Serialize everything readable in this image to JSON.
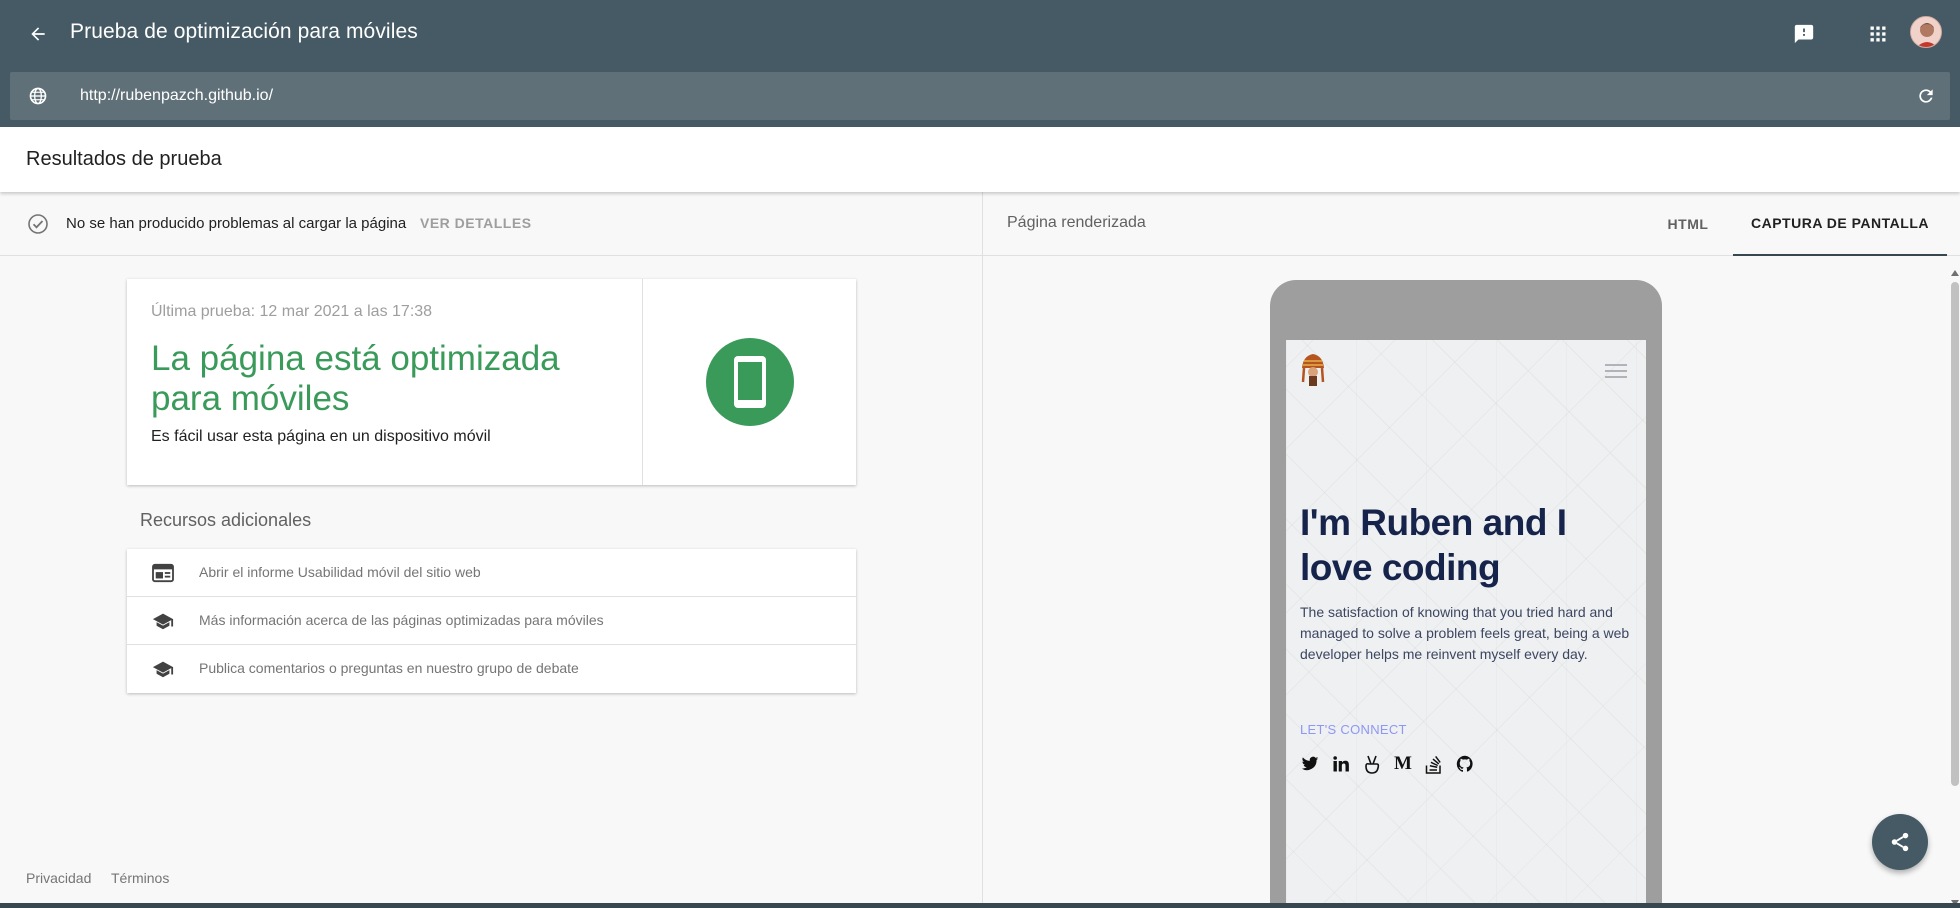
{
  "header": {
    "app_title": "Prueba de optimización para móviles",
    "back_icon": "arrow-back-icon",
    "feedback_icon": "feedback-icon",
    "apps_icon": "apps-grid-icon",
    "avatar_icon": "user-avatar"
  },
  "url_bar": {
    "url": "http://rubenpazch.github.io/",
    "globe_icon": "globe-icon",
    "reload_icon": "reload-icon"
  },
  "results": {
    "title": "Resultados de prueba"
  },
  "status": {
    "text": "No se han producido problemas al cargar la página",
    "details_link": "VER DETALLES",
    "icon": "check-circle-icon"
  },
  "summary_card": {
    "last_test": "Última prueba: 12 mar 2021 a las 17:38",
    "verdict": "La página está optimizada para móviles",
    "subtitle": "Es fácil usar esta página en un dispositivo móvil",
    "icon": "smartphone-icon",
    "accent_color": "#3a9a5a"
  },
  "resources": {
    "title": "Recursos adicionales",
    "items": [
      {
        "label": "Abrir el informe Usabilidad móvil del sitio web",
        "icon": "web-report-icon"
      },
      {
        "label": "Más información acerca de las páginas optimizadas para móviles",
        "icon": "school-cap-icon"
      },
      {
        "label": "Publica comentarios o preguntas en nuestro grupo de debate",
        "icon": "school-cap-icon"
      }
    ]
  },
  "footer": {
    "privacy": "Privacidad",
    "terms": "Términos"
  },
  "rendered_panel": {
    "label": "Página renderizada",
    "tabs": [
      {
        "label": "HTML",
        "active": false
      },
      {
        "label": "CAPTURA DE PANTALLA",
        "active": true
      }
    ]
  },
  "preview_site": {
    "heading": "I'm Ruben and I love coding",
    "intro": "The satisfaction of knowing that you tried hard and managed to solve a problem feels great, being a web developer helps me reinvent myself every day.",
    "connect_label": "LET'S CONNECT",
    "social_icons": [
      "twitter-icon",
      "linkedin-icon",
      "angellist-icon",
      "medium-icon",
      "stackoverflow-icon",
      "github-icon"
    ],
    "medium_glyph": "M",
    "heading_color": "#16234a",
    "connect_color": "#8f97f5"
  },
  "share_fab": {
    "icon": "share-icon"
  },
  "theme": {
    "header_color": "#455a64",
    "urlbar_color": "#607078"
  }
}
